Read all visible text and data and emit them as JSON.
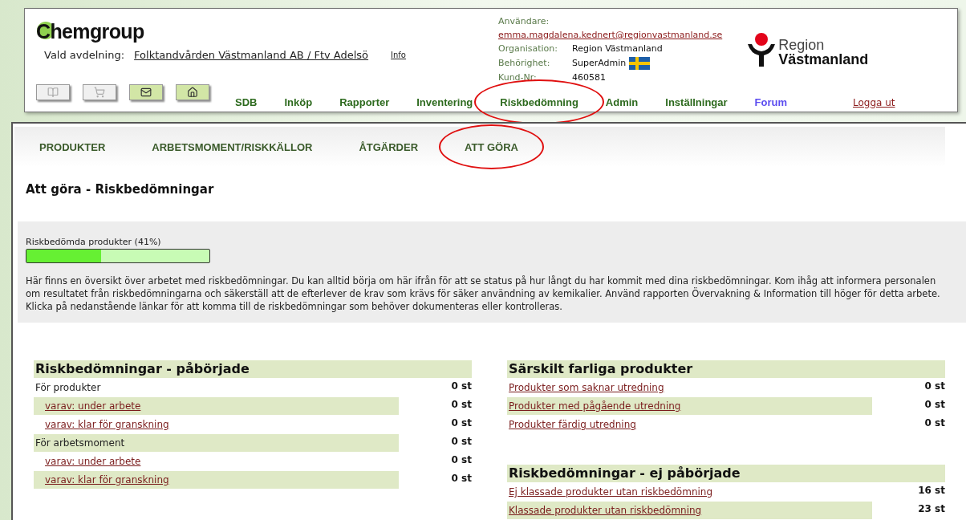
{
  "header": {
    "logo": "Chemgroup",
    "department_label": "Vald avdelning:",
    "department": "Folktandvården Västmanland AB / Ftv Adelsö",
    "info_link": "Info",
    "user": {
      "label": "Användare:",
      "email": "emma.magdalena.kednert@regionvastmanland.se",
      "fields": [
        {
          "label": "Organisation:",
          "value": "Region Västmanland",
          "flag": false
        },
        {
          "label": "Behörighet:",
          "value": "SuperAdmin",
          "flag": true
        },
        {
          "label": "Kund-Nr:",
          "value": "460581",
          "flag": false
        }
      ]
    },
    "region_logo": {
      "line1": "Region",
      "line2": "Västmanland"
    },
    "toolbar": [
      {
        "disabled": true
      },
      {
        "disabled": true
      },
      {
        "disabled": false
      },
      {
        "disabled": false
      }
    ],
    "nav": [
      {
        "label": "SDB",
        "kind": "menu",
        "highlighted": false
      },
      {
        "label": "Inköp",
        "kind": "menu",
        "highlighted": false
      },
      {
        "label": "Rapporter",
        "kind": "menu",
        "highlighted": false
      },
      {
        "label": "Inventering",
        "kind": "menu",
        "highlighted": false
      },
      {
        "label": "Riskbedömning",
        "kind": "menu",
        "highlighted": true
      },
      {
        "label": "Admin",
        "kind": "menu",
        "highlighted": false
      },
      {
        "label": "Inställningar",
        "kind": "menu",
        "highlighted": false
      },
      {
        "label": "Forum",
        "kind": "forum",
        "highlighted": false
      },
      {
        "label": "Logga ut",
        "kind": "logout",
        "highlighted": false
      }
    ]
  },
  "tabs": [
    {
      "label": "PRODUKTER",
      "highlighted": false
    },
    {
      "label": "ARBETSMOMENT/RISKKÄLLOR",
      "highlighted": false
    },
    {
      "label": "ÅTGÄRDER",
      "highlighted": false
    },
    {
      "label": "ATT GÖRA",
      "highlighted": true
    }
  ],
  "page_title": "Att göra - Riskbedömningar",
  "progress": {
    "label": "Riskbedömda produkter (41%)",
    "level": 0.41
  },
  "intro": "Här finns en översikt över arbetet med riskbedömningar. Du kan alltid börja om här ifrån för att se status på hur långt du har kommit med dina riskbedömningar. Kom ihåg att informera personalen om resultatet från riskbedömningarna och säkerställ att de efterlever de krav som krävs för säker användning av kemikalier. Använd rapporten Övervakning & Information till höger för detta arbete. Klicka på nedanstående länkar för att komma till de riskbedömningar som behöver dokumenteras eller kontrolleras.",
  "left_panels": [
    {
      "title": "Riskbedömningar - påbörjade",
      "rows": [
        {
          "label": "För produkter",
          "kind": "text",
          "count": "0 st",
          "children": [
            {
              "label": "varav: under arbete",
              "kind": "link",
              "count": "0 st"
            },
            {
              "label": "varav: klar för granskning",
              "kind": "link",
              "count": "0 st"
            }
          ]
        },
        {
          "label": "För arbetsmoment",
          "kind": "text",
          "count": "0 st",
          "children": [
            {
              "label": "varav: under arbete",
              "kind": "link",
              "count": "0 st"
            },
            {
              "label": "varav: klar för granskning",
              "kind": "link",
              "count": "0 st"
            }
          ]
        }
      ]
    }
  ],
  "right_panels": [
    {
      "title": "Särskilt farliga produkter",
      "rows": [
        {
          "label": "Produkter som saknar utredning",
          "kind": "link",
          "count": "0 st"
        },
        {
          "label": "Produkter med pågående utredning",
          "kind": "link",
          "count": "0 st"
        },
        {
          "label": "Produkter färdig utredning",
          "kind": "link",
          "count": "0 st"
        }
      ]
    },
    {
      "title": "Riskbedömningar - ej påbörjade",
      "rows": [
        {
          "label": "Ej klassade produkter utan riskbedömning",
          "kind": "link",
          "count": "16 st"
        },
        {
          "label": "Klassade produkter utan riskbedömning",
          "kind": "link",
          "count": "23 st"
        }
      ]
    }
  ]
}
